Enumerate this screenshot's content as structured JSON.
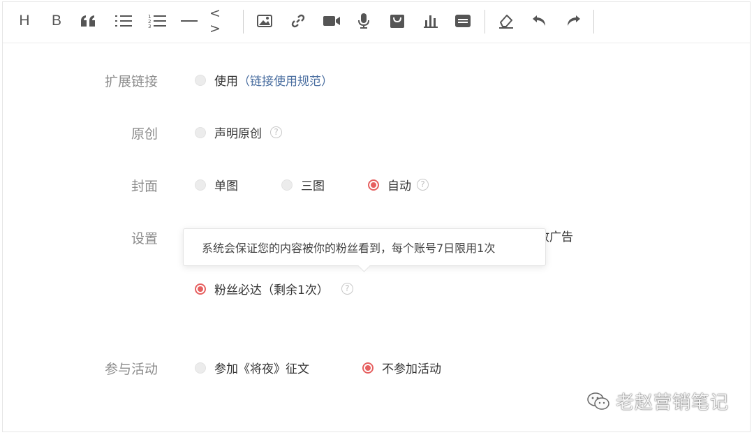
{
  "toolbar": {
    "heading": "H",
    "bold": "B",
    "quote": "❝",
    "code": "< >"
  },
  "form": {
    "ext_link": {
      "label": "扩展链接",
      "option": "使用",
      "link_text": "链接使用规范",
      "open_paren": "（",
      "close_paren": "）"
    },
    "original": {
      "label": "原创",
      "option": "声明原创",
      "help": "?"
    },
    "cover": {
      "label": "封面",
      "options": [
        {
          "text": "单图",
          "checked": false
        },
        {
          "text": "三图",
          "checked": false
        },
        {
          "text": "自动",
          "checked": true
        }
      ],
      "help": "?"
    },
    "settings": {
      "label": "设置",
      "partial_text": "故广告",
      "fans_option": "粉丝必达（剩余1次）",
      "help": "?",
      "tooltip": "系统会保证您的内容被你的粉丝看到，每个账号7日限用1次"
    },
    "activity": {
      "label": "参与活动",
      "options": [
        {
          "text": "参加《将夜》征文",
          "checked": false
        },
        {
          "text": "不参加活动",
          "checked": true
        }
      ]
    }
  },
  "watermark": {
    "text": "老赵营销笔记"
  },
  "colors": {
    "accent": "#e66060",
    "link": "#4a6ea0",
    "label": "#8c8c8c"
  }
}
